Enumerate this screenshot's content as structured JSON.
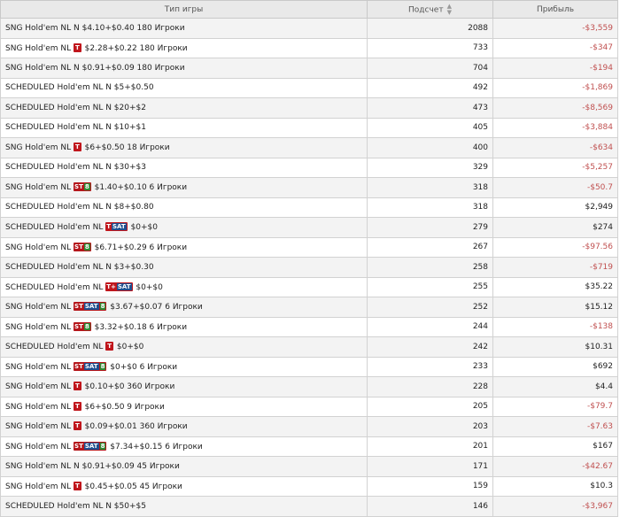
{
  "header": {
    "game_type": "Тип игры",
    "count": "Подсчет",
    "profit": "Прибыль"
  },
  "rows": [
    {
      "prefix": "SNG Hold'em NL N",
      "badge": "",
      "rest": " $4.10+$0.40 180 Игроки",
      "count": "2088",
      "profit": "-$3,559",
      "neg": true
    },
    {
      "prefix": "SNG Hold'em NL",
      "badge": "T",
      "rest": " $2.28+$0.22 180 Игроки",
      "count": "733",
      "profit": "-$347",
      "neg": true
    },
    {
      "prefix": "SNG Hold'em NL N",
      "badge": "",
      "rest": " $0.91+$0.09 180 Игроки",
      "count": "704",
      "profit": "-$194",
      "neg": true
    },
    {
      "prefix": "SCHEDULED Hold'em NL N",
      "badge": "",
      "rest": " $5+$0.50",
      "count": "492",
      "profit": "-$1,869",
      "neg": true
    },
    {
      "prefix": "SCHEDULED Hold'em NL N",
      "badge": "",
      "rest": " $20+$2",
      "count": "473",
      "profit": "-$8,569",
      "neg": true
    },
    {
      "prefix": "SCHEDULED Hold'em NL N",
      "badge": "",
      "rest": " $10+$1",
      "count": "405",
      "profit": "-$3,884",
      "neg": true
    },
    {
      "prefix": "SNG Hold'em NL",
      "badge": "T",
      "rest": " $6+$0.50 18 Игроки",
      "count": "400",
      "profit": "-$634",
      "neg": true
    },
    {
      "prefix": "SCHEDULED Hold'em NL N",
      "badge": "",
      "rest": " $30+$3",
      "count": "329",
      "profit": "-$5,257",
      "neg": true
    },
    {
      "prefix": "SNG Hold'em NL",
      "badge": "ST8",
      "rest": " $1.40+$0.10 6 Игроки",
      "count": "318",
      "profit": "-$50.7",
      "neg": true
    },
    {
      "prefix": "SCHEDULED Hold'em NL N",
      "badge": "",
      "rest": " $8+$0.80",
      "count": "318",
      "profit": "$2,949",
      "neg": false
    },
    {
      "prefix": "SCHEDULED Hold'em NL",
      "badge": "TSAT",
      "rest": " $0+$0",
      "count": "279",
      "profit": "$274",
      "neg": false
    },
    {
      "prefix": "SNG Hold'em NL",
      "badge": "ST8",
      "rest": " $6.71+$0.29 6 Игроки",
      "count": "267",
      "profit": "-$97.56",
      "neg": true
    },
    {
      "prefix": "SCHEDULED Hold'em NL N",
      "badge": "",
      "rest": " $3+$0.30",
      "count": "258",
      "profit": "-$719",
      "neg": true
    },
    {
      "prefix": "SCHEDULED Hold'em NL",
      "badge": "T+SAT",
      "rest": " $0+$0",
      "count": "255",
      "profit": "$35.22",
      "neg": false
    },
    {
      "prefix": "SNG Hold'em NL",
      "badge": "STSAT8",
      "rest": " $3.67+$0.07 6 Игроки",
      "count": "252",
      "profit": "$15.12",
      "neg": false
    },
    {
      "prefix": "SNG Hold'em NL",
      "badge": "ST8",
      "rest": " $3.32+$0.18 6 Игроки",
      "count": "244",
      "profit": "-$138",
      "neg": true
    },
    {
      "prefix": "SCHEDULED Hold'em NL",
      "badge": "T",
      "rest": " $0+$0",
      "count": "242",
      "profit": "$10.31",
      "neg": false
    },
    {
      "prefix": "SNG Hold'em NL",
      "badge": "STSAT8",
      "rest": " $0+$0 6 Игроки",
      "count": "233",
      "profit": "$692",
      "neg": false
    },
    {
      "prefix": "SNG Hold'em NL",
      "badge": "T",
      "rest": " $0.10+$0 360 Игроки",
      "count": "228",
      "profit": "$4.4",
      "neg": false
    },
    {
      "prefix": "SNG Hold'em NL",
      "badge": "T",
      "rest": " $6+$0.50 9 Игроки",
      "count": "205",
      "profit": "-$79.7",
      "neg": true
    },
    {
      "prefix": "SNG Hold'em NL",
      "badge": "T",
      "rest": " $0.09+$0.01 360 Игроки",
      "count": "203",
      "profit": "-$7.63",
      "neg": true
    },
    {
      "prefix": "SNG Hold'em NL",
      "badge": "STSAT8",
      "rest": " $7.34+$0.15 6 Игроки",
      "count": "201",
      "profit": "$167",
      "neg": false
    },
    {
      "prefix": "SNG Hold'em NL N",
      "badge": "",
      "rest": " $0.91+$0.09 45 Игроки",
      "count": "171",
      "profit": "-$42.67",
      "neg": true
    },
    {
      "prefix": "SNG Hold'em NL",
      "badge": "T",
      "rest": " $0.45+$0.05 45 Игроки",
      "count": "159",
      "profit": "$10.3",
      "neg": false
    },
    {
      "prefix": "SCHEDULED Hold'em NL N",
      "badge": "",
      "rest": " $50+$5",
      "count": "146",
      "profit": "-$3,967",
      "neg": true
    }
  ],
  "colors": {
    "negative": "#c05050",
    "positive": "#222222",
    "header_bg": "#e9e9e9",
    "row_odd": "#f3f3f3",
    "row_even": "#ffffff"
  },
  "icons": {
    "sort": "sort-arrows-icon"
  }
}
